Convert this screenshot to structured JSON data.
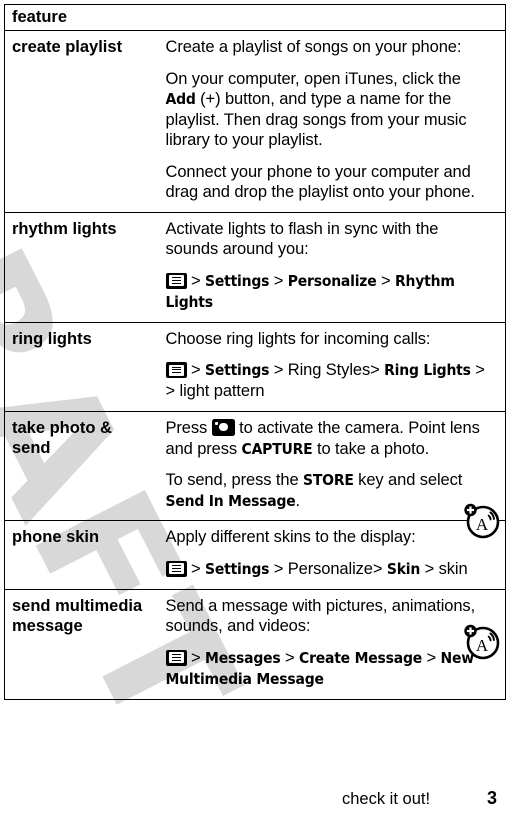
{
  "document": {
    "watermark": "DRAFT"
  },
  "table": {
    "header": {
      "label": "feature"
    },
    "rows": [
      {
        "name": "create playlist",
        "paragraphs": [
          {
            "type": "text",
            "parts": [
              {
                "t": "Create a playlist of songs on your phone:"
              }
            ]
          },
          {
            "type": "text",
            "parts": [
              {
                "t": "On your computer, open iTunes, click the "
              },
              {
                "t": "Add",
                "ui": true
              },
              {
                "t": " (+) button, and type a name for the playlist. Then drag songs from your music library to your playlist."
              }
            ]
          },
          {
            "type": "text",
            "parts": [
              {
                "t": "Connect your phone to your computer and drag and drop the playlist onto your phone."
              }
            ]
          }
        ]
      },
      {
        "name": "rhythm lights",
        "paragraphs": [
          {
            "type": "text",
            "parts": [
              {
                "t": "Activate lights to flash in sync with the sounds around you:"
              }
            ]
          },
          {
            "type": "path",
            "icon": "menu-icon",
            "parts": [
              {
                "t": " > ",
                "sep": true
              },
              {
                "t": "Settings",
                "ui": true
              },
              {
                "t": " > ",
                "sep": true
              },
              {
                "t": "Personalize",
                "ui": true
              },
              {
                "t": " > ",
                "sep": true
              },
              {
                "t": "Rhythm Lights",
                "ui": true
              }
            ]
          }
        ]
      },
      {
        "name": "ring lights",
        "paragraphs": [
          {
            "type": "text",
            "parts": [
              {
                "t": "Choose ring lights for incoming calls:"
              }
            ]
          },
          {
            "type": "path",
            "icon": "menu-icon",
            "parts": [
              {
                "t": " > ",
                "sep": true
              },
              {
                "t": "Settings",
                "ui": true
              },
              {
                "t": " > Ring Styles> ",
                "sep": true
              },
              {
                "t": "Ring Lights",
                "ui": true
              },
              {
                "t": " > > light pattern",
                "sep": true
              }
            ]
          }
        ]
      },
      {
        "name": "take photo & send",
        "paragraphs": [
          {
            "type": "text",
            "icon_inline": "camera-icon",
            "parts": [
              {
                "t": "Press "
              },
              {
                "t": "@camera-icon",
                "icon": true
              },
              {
                "t": " to activate the camera. Point lens and press "
              },
              {
                "t": "CAPTURE",
                "ui": true
              },
              {
                "t": " to take a photo."
              }
            ]
          },
          {
            "type": "text",
            "parts": [
              {
                "t": "To send, press the "
              },
              {
                "t": "STORE",
                "ui": true
              },
              {
                "t": " key and select "
              },
              {
                "t": "Send In Message",
                "ui": true
              },
              {
                "t": "."
              }
            ]
          }
        ]
      },
      {
        "name": "phone skin",
        "paragraphs": [
          {
            "type": "text",
            "parts": [
              {
                "t": "Apply different skins to the display:"
              }
            ]
          },
          {
            "type": "path",
            "icon": "menu-icon",
            "parts": [
              {
                "t": " > ",
                "sep": true
              },
              {
                "t": "Settings",
                "ui": true
              },
              {
                "t": " > Personalize> ",
                "sep": true
              },
              {
                "t": "Skin",
                "ui": true
              },
              {
                "t": " >  skin",
                "sep": true
              }
            ]
          }
        ]
      },
      {
        "name": "send multimedia message",
        "paragraphs": [
          {
            "type": "text",
            "parts": [
              {
                "t": "Send a message with pictures, animations, sounds, and videos:"
              }
            ]
          },
          {
            "type": "path",
            "icon": "menu-icon",
            "parts": [
              {
                "t": " > ",
                "sep": true
              },
              {
                "t": "Messages",
                "ui": true
              },
              {
                "t": " > ",
                "sep": true
              },
              {
                "t": "Create Message",
                "ui": true
              },
              {
                "t": "  > ",
                "sep": true
              },
              {
                "t": "New Multimedia Message",
                "ui": true
              }
            ]
          }
        ]
      }
    ]
  },
  "margin_icons": [
    {
      "name": "network-service-icon",
      "row": "take photo & send"
    },
    {
      "name": "network-service-icon",
      "row": "send multimedia message"
    }
  ],
  "footer": {
    "note": "check it out!",
    "page_number": "3"
  }
}
